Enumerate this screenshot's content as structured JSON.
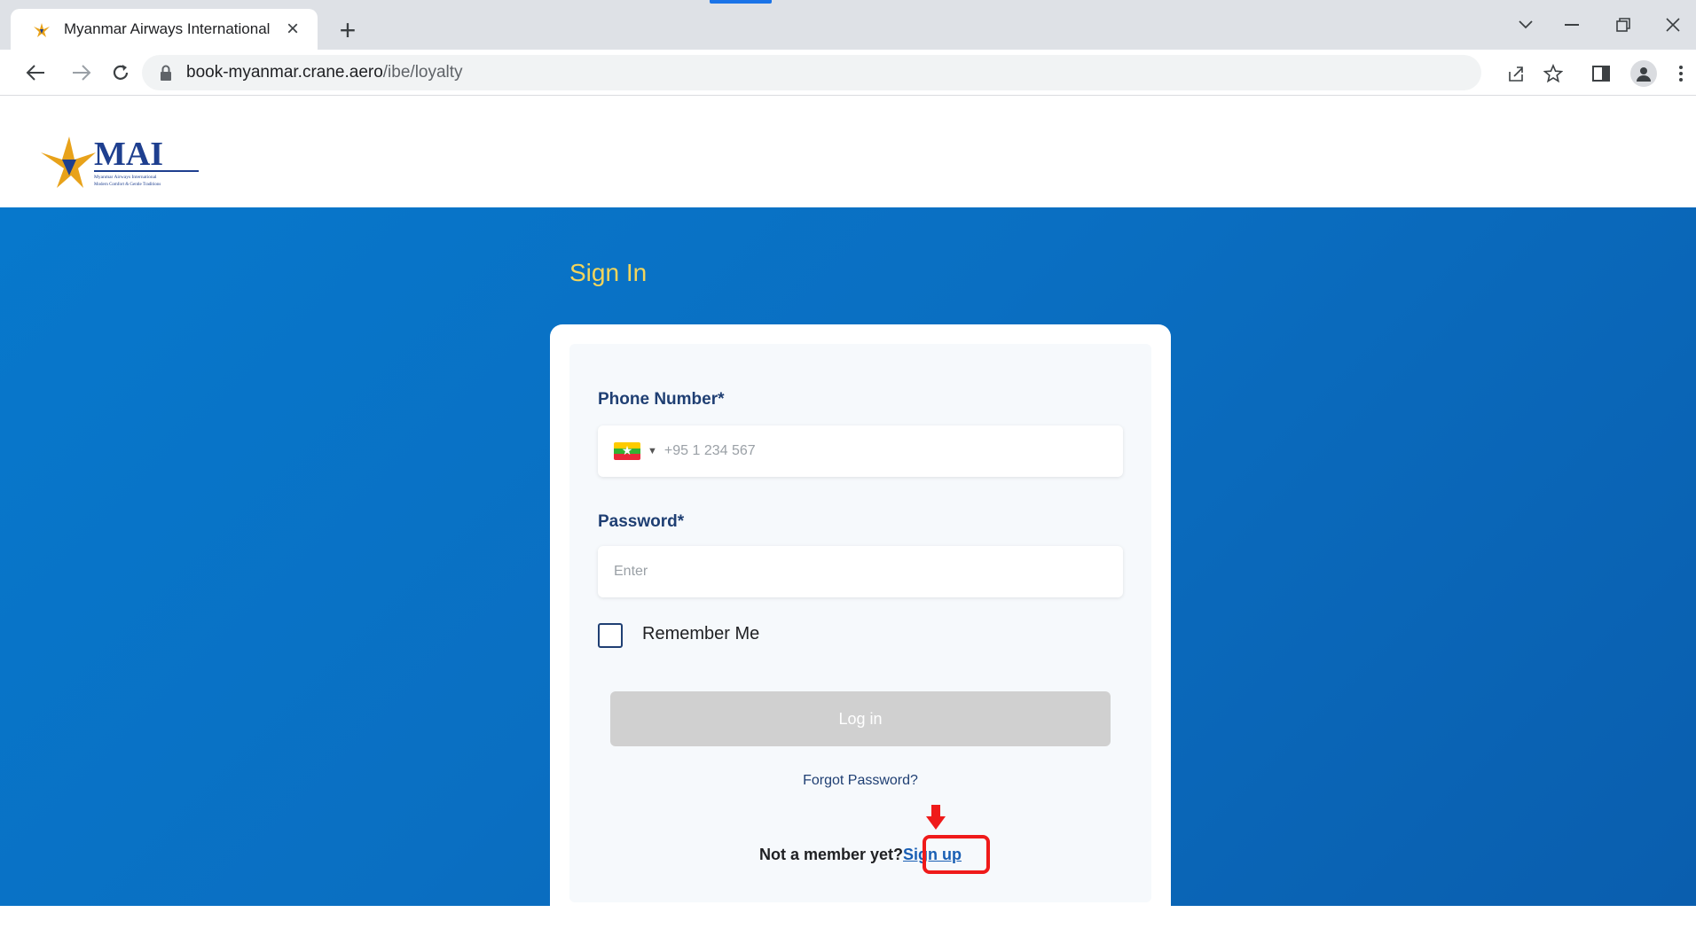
{
  "browser": {
    "tab_title": "Myanmar Airways International",
    "tab_close": "×",
    "new_tab": "+",
    "url_host": "book-myanmar.crane.aero",
    "url_path": "/ibe/loyalty",
    "icons": [
      "back-arrow-icon",
      "forward-arrow-icon",
      "reload-icon",
      "lock-icon",
      "share-icon",
      "star-icon",
      "sidepanel-icon",
      "profile-icon",
      "menu-dots-icon"
    ]
  },
  "header": {
    "logo_text": "MAI",
    "logo_subtitle_1": "Myanmar Airways International",
    "logo_subtitle_2": "Modern Comfort & Gentle Traditions"
  },
  "signin": {
    "heading": "Sign In",
    "phone_label": "Phone Number*",
    "phone_placeholder": "+95 1 234 567",
    "password_label": "Password*",
    "password_placeholder": "Enter",
    "remember_label": "Remember Me",
    "login_label": "Log in",
    "forgot_label": "Forgot Password?",
    "not_member_text": "Not a member yet?",
    "signup_label": "Sign up"
  },
  "colors": {
    "hero_bg": "#0a6fc2",
    "heading": "#f3d55b",
    "label": "#1f3f73",
    "login_disabled": "#d0d0d0",
    "annotation": "#ef1a1a"
  }
}
